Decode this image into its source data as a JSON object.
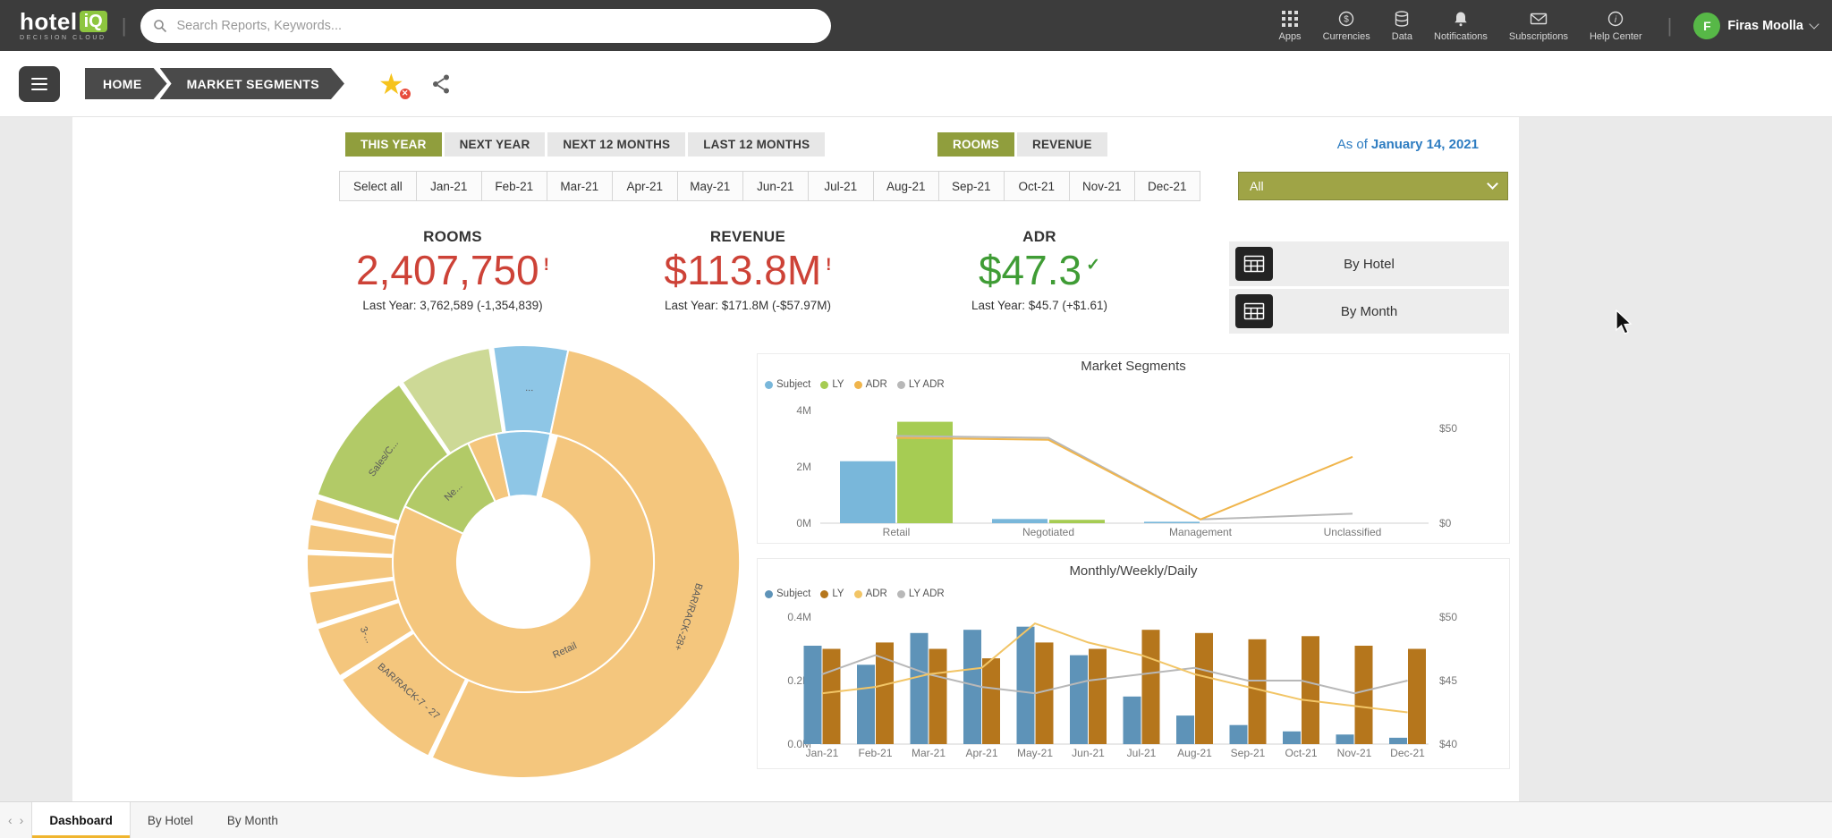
{
  "colors": {
    "topbar_bg": "#3c3c3c",
    "brand_green": "#8dc63f",
    "accent_olive": "#909e3d",
    "dropdown_olive": "#9fa446",
    "kpi_red": "#cd4237",
    "kpi_green": "#3f9c35",
    "date_blue": "#2d7cc1",
    "active_tab_underline": "#f0b52e"
  },
  "topbar": {
    "logo": {
      "hotel": "hotel",
      "iq": "iQ",
      "subtitle": "DECISION CLOUD"
    },
    "search_placeholder": "Search Reports, Keywords...",
    "nav_items": [
      {
        "label": "Apps",
        "icon": "apps-grid-icon"
      },
      {
        "label": "Currencies",
        "icon": "currency-icon"
      },
      {
        "label": "Data",
        "icon": "database-icon"
      },
      {
        "label": "Notifications",
        "icon": "bell-icon"
      },
      {
        "label": "Subscriptions",
        "icon": "envelope-icon"
      },
      {
        "label": "Help Center",
        "icon": "help-icon"
      }
    ],
    "user": {
      "initial": "F",
      "name": "Firas Moolla"
    }
  },
  "toolbar": {
    "breadcrumbs": [
      "HOME",
      "MARKET SEGMENTS"
    ]
  },
  "filters": {
    "period_tabs": [
      {
        "label": "THIS YEAR",
        "selected": true
      },
      {
        "label": "NEXT YEAR",
        "selected": false
      },
      {
        "label": "NEXT 12 MONTHS",
        "selected": false
      },
      {
        "label": "LAST 12 MONTHS",
        "selected": false
      }
    ],
    "metric_tabs": [
      {
        "label": "ROOMS",
        "selected": true
      },
      {
        "label": "REVENUE",
        "selected": false
      }
    ],
    "as_of_prefix": "As of",
    "as_of_date": "January 14, 2021",
    "months": [
      "Select all",
      "Jan-21",
      "Feb-21",
      "Mar-21",
      "Apr-21",
      "May-21",
      "Jun-21",
      "Jul-21",
      "Aug-21",
      "Sep-21",
      "Oct-21",
      "Nov-21",
      "Dec-21"
    ],
    "hotel_dropdown_value": "All"
  },
  "kpis": [
    {
      "title": "ROOMS",
      "value": "2,407,750",
      "indicator": "!",
      "trend": "down",
      "subtext": "Last Year: 3,762,589 (-1,354,839)"
    },
    {
      "title": "REVENUE",
      "value": "$113.8M",
      "indicator": "!",
      "trend": "down",
      "subtext": "Last Year: $171.8M (-$57.97M)"
    },
    {
      "title": "ADR",
      "value": "$47.3",
      "indicator": "✓",
      "trend": "up",
      "subtext": "Last Year: $45.7 (+$1.61)"
    }
  ],
  "side_buttons": [
    {
      "label": "By Hotel"
    },
    {
      "label": "By Month"
    }
  ],
  "bottom_tabs": [
    {
      "label": "Dashboard",
      "active": true
    },
    {
      "label": "By Hotel",
      "active": false
    },
    {
      "label": "By Month",
      "active": false
    }
  ],
  "chart_data": [
    {
      "type": "pie",
      "variant": "sunburst",
      "title": "",
      "palette": {
        "tan": "#f4c67d",
        "blue": "#8ec6e6",
        "green": "#b2ca67",
        "green_light": "#cdd996"
      },
      "segments": [
        {
          "ring": "outer",
          "label": "...",
          "start": 352,
          "end": 372,
          "color": "blue"
        },
        {
          "ring": "outer",
          "label": "BAR/RACK-28+",
          "start": 12,
          "end": 205,
          "color": "tan"
        },
        {
          "ring": "outer",
          "label": "BAR/RACK-7 - 27",
          "start": 206,
          "end": 237,
          "color": "tan"
        },
        {
          "ring": "outer",
          "label": "3-...",
          "start": 238,
          "end": 252,
          "color": "tan"
        },
        {
          "ring": "outer",
          "label": "",
          "start": 253,
          "end": 262,
          "color": "tan"
        },
        {
          "ring": "outer",
          "label": "",
          "start": 263,
          "end": 272,
          "color": "tan"
        },
        {
          "ring": "outer",
          "label": "",
          "start": 273,
          "end": 280,
          "color": "tan"
        },
        {
          "ring": "outer",
          "label": "",
          "start": 281,
          "end": 287,
          "color": "tan"
        },
        {
          "ring": "outer",
          "label": "Sales/C...",
          "start": 288,
          "end": 325,
          "color": "green"
        },
        {
          "ring": "outer",
          "label": "",
          "start": 326,
          "end": 351,
          "color": "green_light"
        },
        {
          "ring": "inner",
          "label": "Retail",
          "start": 15,
          "end": 295,
          "color": "tan"
        },
        {
          "ring": "inner",
          "label": "Ne...",
          "start": 295,
          "end": 335,
          "color": "green"
        },
        {
          "ring": "inner",
          "label": "",
          "start": 335,
          "end": 348,
          "color": "tan"
        },
        {
          "ring": "inner",
          "label": "",
          "start": 348,
          "end": 372,
          "color": "blue"
        }
      ]
    },
    {
      "type": "bar",
      "variant": "combo",
      "title": "Market Segments",
      "categories": [
        "Retail",
        "Negotiated",
        "Management",
        "Unclassified"
      ],
      "series": [
        {
          "name": "Subject",
          "type": "bar",
          "color": "#79b7da",
          "values": [
            2.2,
            0.15,
            0.05,
            0
          ]
        },
        {
          "name": "LY",
          "type": "bar",
          "color": "#a6cc53",
          "values": [
            3.6,
            0.12,
            0,
            0
          ]
        },
        {
          "name": "ADR",
          "type": "line",
          "color": "#f0b54c",
          "values": [
            45,
            44,
            2,
            35
          ]
        },
        {
          "name": "LY ADR",
          "type": "line",
          "color": "#b8b8b8",
          "values": [
            46,
            45,
            2,
            5
          ]
        }
      ],
      "y_left": {
        "ticks": [
          "4M",
          "2M",
          "0M"
        ],
        "max": 4,
        "unit": "M"
      },
      "y_right": {
        "ticks": [
          "$50",
          "$0"
        ],
        "min": 0,
        "max": 50,
        "unit": "$"
      },
      "legend_position": "top-left",
      "grid": false
    },
    {
      "type": "bar",
      "variant": "combo",
      "title": "Monthly/Weekly/Daily",
      "categories": [
        "Jan-21",
        "Feb-21",
        "Mar-21",
        "Apr-21",
        "May-21",
        "Jun-21",
        "Jul-21",
        "Aug-21",
        "Sep-21",
        "Oct-21",
        "Nov-21",
        "Dec-21"
      ],
      "series": [
        {
          "name": "Subject",
          "type": "bar",
          "color": "#5e93b8",
          "values": [
            0.31,
            0.25,
            0.35,
            0.36,
            0.37,
            0.28,
            0.15,
            0.09,
            0.06,
            0.04,
            0.03,
            0.02
          ]
        },
        {
          "name": "LY",
          "type": "bar",
          "color": "#b5761c",
          "values": [
            0.3,
            0.32,
            0.3,
            0.27,
            0.32,
            0.3,
            0.36,
            0.35,
            0.33,
            0.34,
            0.31,
            0.3
          ]
        },
        {
          "name": "ADR",
          "type": "line",
          "color": "#f2c566",
          "values": [
            44,
            44.5,
            45.5,
            46,
            49.5,
            48,
            47,
            45.5,
            44.5,
            43.5,
            43,
            42.5
          ]
        },
        {
          "name": "LY ADR",
          "type": "line",
          "color": "#b8b8b8",
          "values": [
            45.5,
            47,
            45.5,
            44.5,
            44,
            45,
            45.5,
            46,
            45,
            45,
            44,
            45
          ]
        }
      ],
      "y_left": {
        "ticks": [
          "0.4M",
          "0.2M",
          "0.0M"
        ],
        "max": 0.4,
        "unit": "M"
      },
      "y_right": {
        "ticks": [
          "$50",
          "$45",
          "$40"
        ],
        "min": 40,
        "max": 50,
        "unit": "$"
      },
      "legend_position": "top-left",
      "grid": false
    }
  ]
}
